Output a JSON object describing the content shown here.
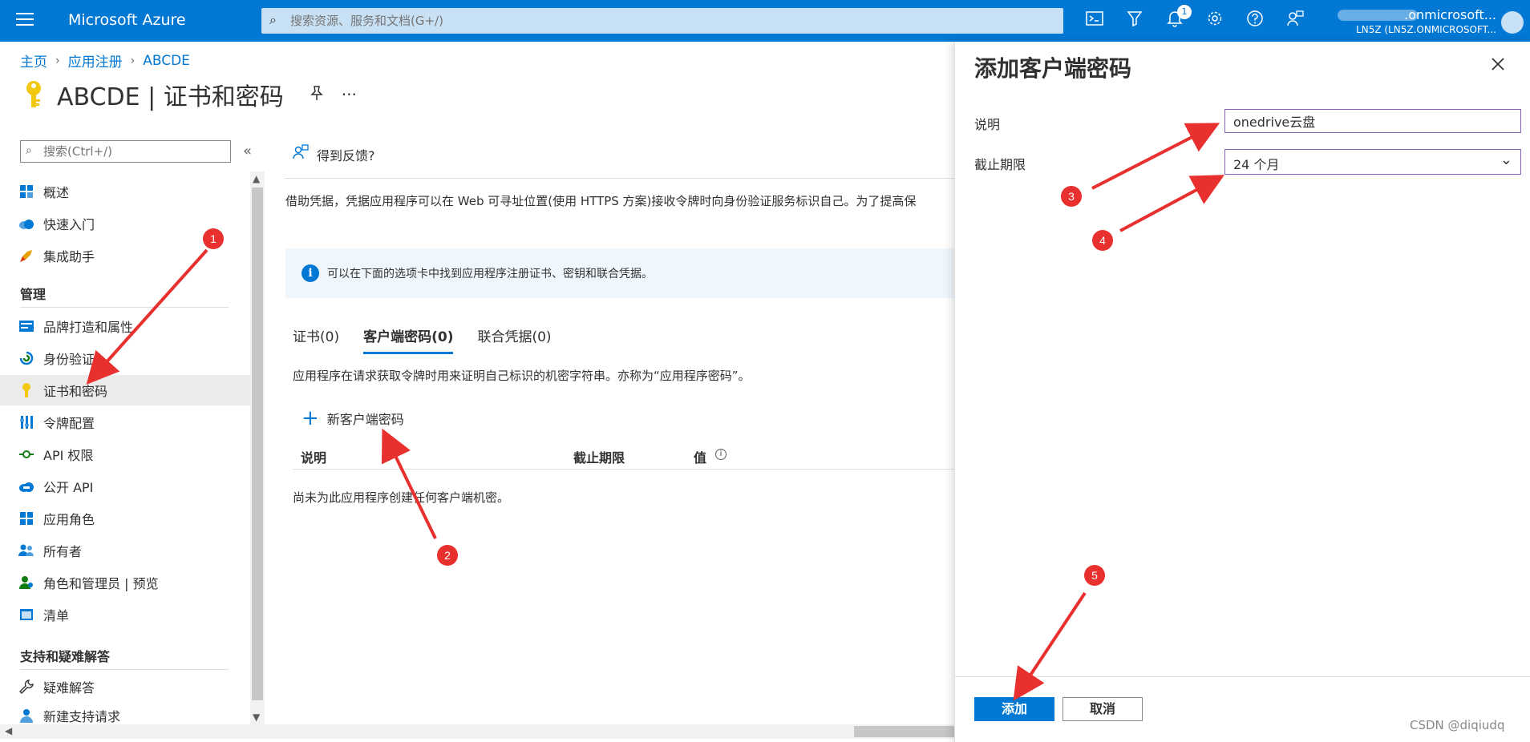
{
  "topbar": {
    "brand": "Microsoft Azure",
    "search_placeholder": "搜索资源、服务和文档(G+/)",
    "notification_count": "1",
    "account_name": ".onmicrosoft...",
    "account_tenant": "LN5Z (LN5Z.ONMICROSOFT...",
    "icons": [
      "cloud-shell-icon",
      "directory-filter-icon",
      "bell-icon",
      "gear-icon",
      "help-icon",
      "feedback-icon"
    ]
  },
  "breadcrumb": {
    "items": [
      "主页",
      "应用注册",
      "ABCDE"
    ]
  },
  "page": {
    "title": "ABCDE | 证书和密码"
  },
  "sidebar": {
    "search_placeholder": "搜索(Ctrl+/)",
    "items": [
      {
        "label": "概述",
        "icon": "grid-icon"
      },
      {
        "label": "快速入门",
        "icon": "cloud-icon"
      },
      {
        "label": "集成助手",
        "icon": "rocket-icon"
      }
    ],
    "section_manage": "管理",
    "manage_items": [
      {
        "label": "品牌打造和属性",
        "icon": "branding-icon"
      },
      {
        "label": "身份验证",
        "icon": "auth-icon"
      },
      {
        "label": "证书和密码",
        "icon": "key-icon"
      },
      {
        "label": "令牌配置",
        "icon": "token-icon"
      },
      {
        "label": "API 权限",
        "icon": "api-permission-icon"
      },
      {
        "label": "公开 API",
        "icon": "cloud-api-icon"
      },
      {
        "label": "应用角色",
        "icon": "app-roles-icon"
      },
      {
        "label": "所有者",
        "icon": "owners-icon"
      },
      {
        "label": "角色和管理员 | 预览",
        "icon": "roles-admin-icon"
      },
      {
        "label": "清单",
        "icon": "manifest-icon"
      }
    ],
    "section_support": "支持和疑难解答",
    "support_items": [
      {
        "label": "疑难解答",
        "icon": "wrench-icon"
      },
      {
        "label": "新建支持请求",
        "icon": "support-icon"
      }
    ]
  },
  "main": {
    "feedback": "得到反馈?",
    "description": "借助凭据，凭据应用程序可以在 Web 可寻址位置(使用 HTTPS 方案)接收令牌时向身份验证服务标识自己。为了提高保",
    "info": "可以在下面的选项卡中找到应用程序注册证书、密钥和联合凭据。",
    "tabs": [
      "证书(0)",
      "客户端密码(0)",
      "联合凭据(0)"
    ],
    "tab_description": "应用程序在请求获取令牌时用来证明自己标识的机密字符串。亦称为“应用程序密码”。",
    "new_secret": "新客户端密码",
    "columns": [
      "说明",
      "截止期限",
      "值"
    ],
    "empty": "尚未为此应用程序创建任何客户端机密。"
  },
  "blade": {
    "title": "添加客户端密码",
    "description_label": "说明",
    "description_value": "onedrive云盘",
    "expiry_label": "截止期限",
    "expiry_value": "24 个月",
    "add_button": "添加",
    "cancel_button": "取消"
  },
  "annotations": [
    "1",
    "2",
    "3",
    "4",
    "5"
  ],
  "watermark": "CSDN @diqiudq",
  "colors": {
    "brand": "#0078d4",
    "annotation": "#e8302f",
    "focus_border": "#8764b8",
    "active_nav": "#edebe9"
  }
}
